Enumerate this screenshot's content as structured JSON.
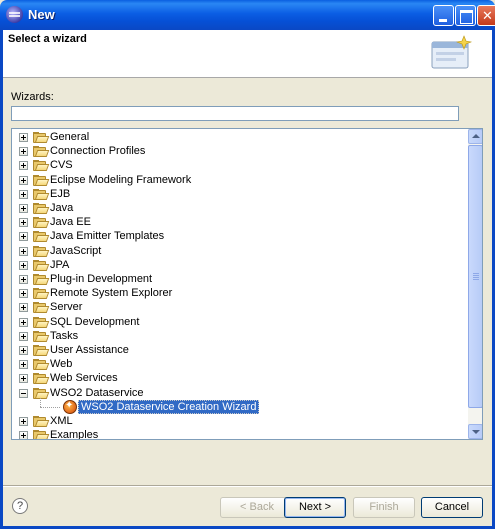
{
  "window": {
    "title": "New"
  },
  "header": {
    "title": "Select a wizard"
  },
  "filter": {
    "label": "Wizards:",
    "value": ""
  },
  "tree": {
    "items": [
      {
        "label": "General",
        "expanded": false
      },
      {
        "label": "Connection Profiles",
        "expanded": false
      },
      {
        "label": "CVS",
        "expanded": false
      },
      {
        "label": "Eclipse Modeling Framework",
        "expanded": false
      },
      {
        "label": "EJB",
        "expanded": false
      },
      {
        "label": "Java",
        "expanded": false
      },
      {
        "label": "Java EE",
        "expanded": false
      },
      {
        "label": "Java Emitter Templates",
        "expanded": false
      },
      {
        "label": "JavaScript",
        "expanded": false
      },
      {
        "label": "JPA",
        "expanded": false
      },
      {
        "label": "Plug-in Development",
        "expanded": false
      },
      {
        "label": "Remote System Explorer",
        "expanded": false
      },
      {
        "label": "Server",
        "expanded": false
      },
      {
        "label": "SQL Development",
        "expanded": false
      },
      {
        "label": "Tasks",
        "expanded": false
      },
      {
        "label": "User Assistance",
        "expanded": false
      },
      {
        "label": "Web",
        "expanded": false
      },
      {
        "label": "Web Services",
        "expanded": false
      },
      {
        "label": "WSO2 Dataservice",
        "expanded": true
      },
      {
        "label": "XML",
        "expanded": false
      },
      {
        "label": "Examples",
        "expanded": false
      }
    ],
    "selected_child": {
      "label": "WSO2 Dataservice Creation Wizard",
      "icon": "wso2-wizard-icon"
    }
  },
  "buttons": {
    "back": "< Back",
    "next": "Next >",
    "finish": "Finish",
    "cancel": "Cancel",
    "help": "?"
  }
}
